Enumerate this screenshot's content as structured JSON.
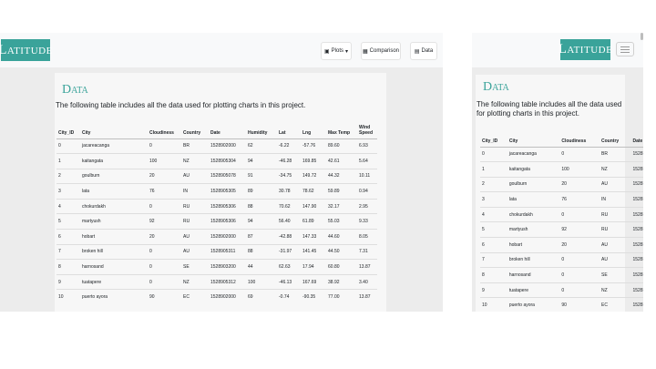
{
  "brand": "Latitude",
  "nav": {
    "plots_label": "Plots",
    "comparison_label": "Comparison",
    "data_label": "Data"
  },
  "section": {
    "title": "Data",
    "description": "The following table includes all the data used for plotting charts in this project."
  },
  "table": {
    "headers": [
      "City_ID",
      "City",
      "Cloudiness",
      "Country",
      "Date",
      "Humidity",
      "Lat",
      "Lng",
      "Max Temp",
      "Wind Speed"
    ],
    "rows": [
      [
        "0",
        "jacareacanga",
        "0",
        "BR",
        "1528902000",
        "62",
        "-6.22",
        "-57.76",
        "89.60",
        "6.93"
      ],
      [
        "1",
        "kaitangata",
        "100",
        "NZ",
        "1528905304",
        "94",
        "-46.28",
        "169.85",
        "42.61",
        "5.64"
      ],
      [
        "2",
        "goulburn",
        "20",
        "AU",
        "1528905078",
        "91",
        "-34.75",
        "149.72",
        "44.32",
        "10.11"
      ],
      [
        "3",
        "lata",
        "76",
        "IN",
        "1528905305",
        "89",
        "30.78",
        "78.62",
        "59.89",
        "0.94"
      ],
      [
        "4",
        "chokurdakh",
        "0",
        "RU",
        "1528905306",
        "88",
        "70.62",
        "147.90",
        "32.17",
        "2.95"
      ],
      [
        "5",
        "martyush",
        "92",
        "RU",
        "1528905306",
        "94",
        "56.40",
        "61.89",
        "55.03",
        "9.33"
      ],
      [
        "6",
        "hobart",
        "20",
        "AU",
        "1528902000",
        "87",
        "-42.88",
        "147.33",
        "44.60",
        "8.05"
      ],
      [
        "7",
        "broken hill",
        "0",
        "AU",
        "1528905311",
        "88",
        "-31.97",
        "141.45",
        "44.50",
        "7.31"
      ],
      [
        "8",
        "harnosand",
        "0",
        "SE",
        "1528903200",
        "44",
        "62.63",
        "17.94",
        "60.80",
        "13.87"
      ],
      [
        "9",
        "tuatapere",
        "0",
        "NZ",
        "1528905312",
        "100",
        "-46.13",
        "167.69",
        "38.92",
        "3.40"
      ],
      [
        "10",
        "puerto ayora",
        "90",
        "EC",
        "1528902000",
        "69",
        "-0.74",
        "-90.35",
        "77.00",
        "13.87"
      ]
    ]
  },
  "mobile_table": {
    "headers": [
      "City_ID",
      "City",
      "Cloudiness",
      "Country",
      "Date"
    ],
    "rows": [
      [
        "0",
        "jacareacanga",
        "0",
        "BR",
        "1528"
      ],
      [
        "1",
        "kaitangata",
        "100",
        "NZ",
        "1528"
      ],
      [
        "2",
        "goulburn",
        "20",
        "AU",
        "1528"
      ],
      [
        "3",
        "lata",
        "76",
        "IN",
        "1528"
      ],
      [
        "4",
        "chokurdakh",
        "0",
        "RU",
        "1528"
      ],
      [
        "5",
        "martyush",
        "92",
        "RU",
        "1528"
      ],
      [
        "6",
        "hobart",
        "20",
        "AU",
        "1528"
      ],
      [
        "7",
        "broken hill",
        "0",
        "AU",
        "1528"
      ],
      [
        "8",
        "harnosand",
        "0",
        "SE",
        "1528"
      ],
      [
        "9",
        "tuatapere",
        "0",
        "NZ",
        "1528"
      ],
      [
        "10",
        "puerto ayora",
        "90",
        "EC",
        "1528"
      ]
    ]
  },
  "icons": {
    "plots": "image-icon",
    "comparison": "grid-icon",
    "data": "table-icon",
    "dropdown": "caret-down-icon",
    "menu": "hamburger-icon"
  },
  "colors": {
    "brand": "#3aa39a",
    "page_background": "#ececec",
    "navbar": "#f8f9fa"
  }
}
